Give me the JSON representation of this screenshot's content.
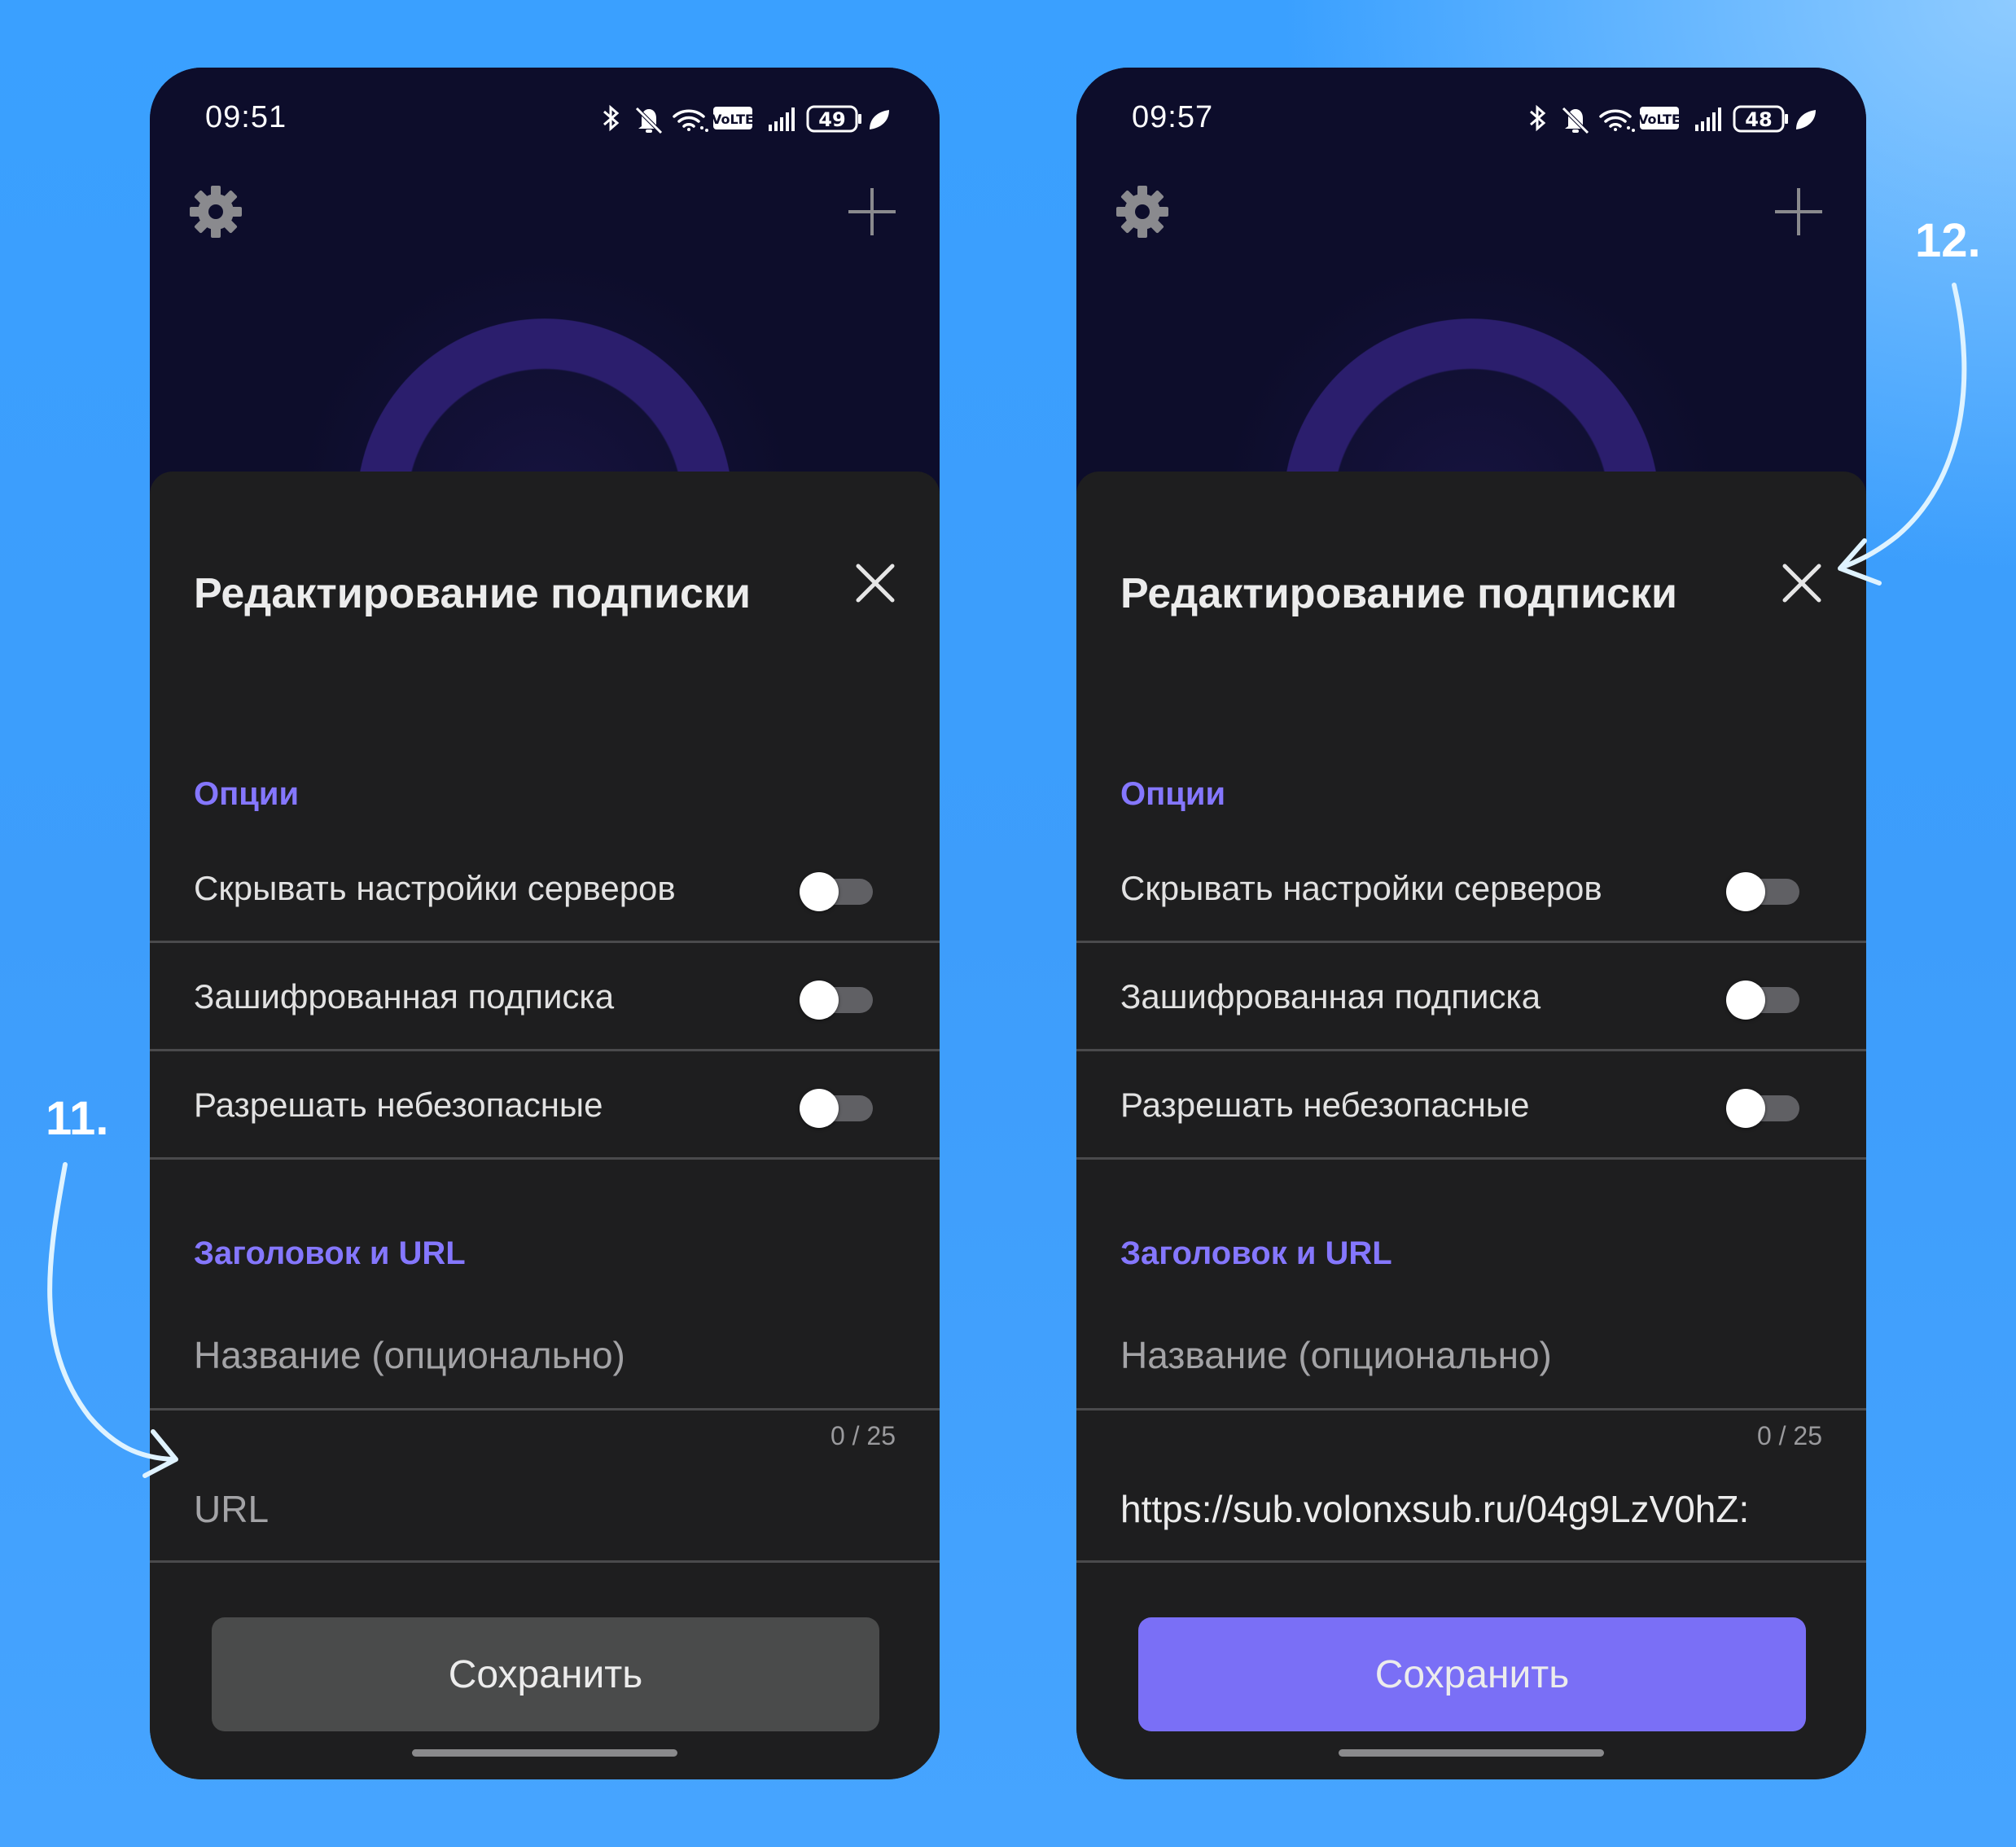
{
  "colors": {
    "background": "#3aa0ff",
    "app_header": "#0d0d2b",
    "sheet": "#1e1e1f",
    "accent": "#8577ff",
    "save_enabled": "#7a6ff6",
    "save_disabled": "#4a4b4b"
  },
  "steps": {
    "step_11": "11.",
    "step_12": "12."
  },
  "screens": [
    {
      "status": {
        "time": "09:51",
        "battery": "49",
        "network": "VoLTE"
      },
      "toolbar": {
        "settings_icon": "gear-icon",
        "add_icon": "plus-icon"
      },
      "sheet": {
        "title": "Редактирование подписки",
        "close_icon": "close-icon",
        "options_heading": "Опции",
        "options": [
          {
            "label": "Скрывать настройки серверов",
            "enabled": false
          },
          {
            "label": "Зашифрованная подписка",
            "enabled": false
          },
          {
            "label": "Разрешать небезопасные",
            "enabled": false
          }
        ],
        "fields_heading": "Заголовок и URL",
        "name_field": {
          "placeholder": "Название (опционально)",
          "value": "",
          "counter": "0 / 25"
        },
        "url_field": {
          "placeholder": "URL",
          "value": ""
        },
        "save_label": "Сохранить",
        "save_enabled": false
      }
    },
    {
      "status": {
        "time": "09:57",
        "battery": "48",
        "network": "VoLTE"
      },
      "toolbar": {
        "settings_icon": "gear-icon",
        "add_icon": "plus-icon"
      },
      "sheet": {
        "title": "Редактирование подписки",
        "close_icon": "close-icon",
        "options_heading": "Опции",
        "options": [
          {
            "label": "Скрывать настройки серверов",
            "enabled": false
          },
          {
            "label": "Зашифрованная подписка",
            "enabled": false
          },
          {
            "label": "Разрешать небезопасные",
            "enabled": false
          }
        ],
        "fields_heading": "Заголовок и URL",
        "name_field": {
          "placeholder": "Название (опционально)",
          "value": "",
          "counter": "0 / 25"
        },
        "url_field": {
          "placeholder": "URL",
          "value": "https://sub.volonxsub.ru/04g9LzV0hZ:"
        },
        "save_label": "Сохранить",
        "save_enabled": true
      }
    }
  ]
}
